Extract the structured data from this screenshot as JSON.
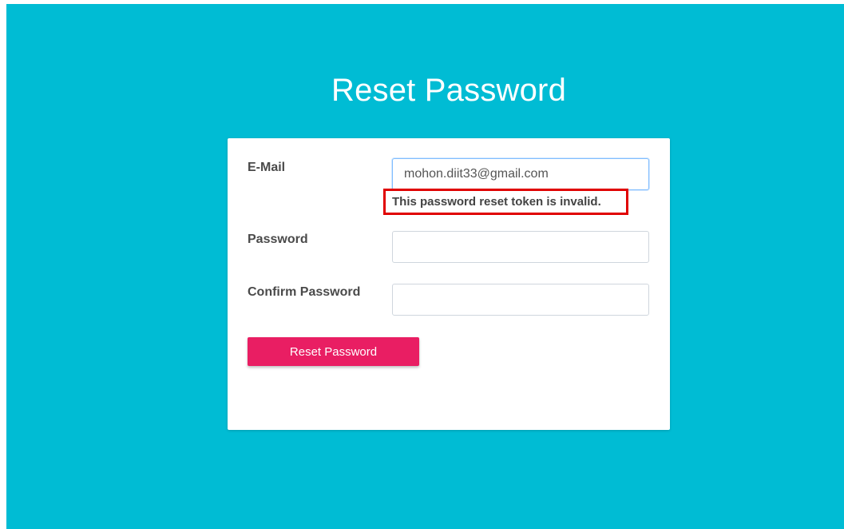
{
  "page": {
    "title": "Reset Password"
  },
  "form": {
    "email": {
      "label": "E-Mail",
      "value": "mohon.diit33@gmail.com",
      "error": "This password reset token is invalid."
    },
    "password": {
      "label": "Password",
      "value": ""
    },
    "confirm_password": {
      "label": "Confirm Password",
      "value": ""
    },
    "submit_label": "Reset Password"
  },
  "colors": {
    "background": "#00bcd4",
    "button": "#e91e63",
    "error_border": "#e00000"
  }
}
